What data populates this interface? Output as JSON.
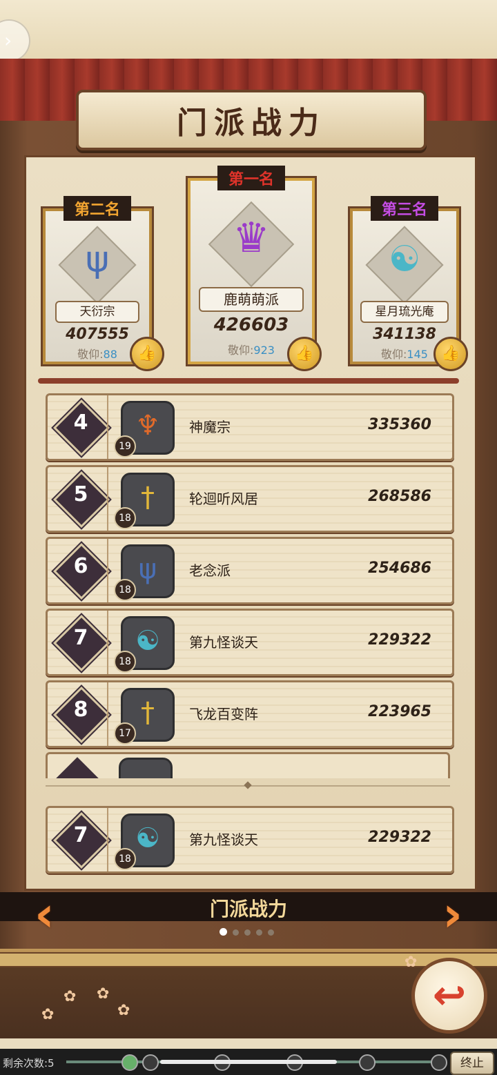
{
  "header": {
    "title": "门派战力"
  },
  "podium": [
    {
      "rank_label": "第二名",
      "rank_color": "#f2a531",
      "name": "天衍宗",
      "power": "407555",
      "respect_label": "敬仰:",
      "respect_value": "88",
      "emblem_icon": "trident-icon",
      "emblem_color": "#4a6fb5"
    },
    {
      "rank_label": "第一名",
      "rank_color": "#e0332a",
      "name": "鹿萌萌派",
      "power": "426603",
      "respect_label": "敬仰:",
      "respect_value": "923",
      "emblem_icon": "flame-crown-icon",
      "emblem_color": "#9a3bc9"
    },
    {
      "rank_label": "第三名",
      "rank_color": "#c44de3",
      "name": "星月琉光庵",
      "power": "341138",
      "respect_label": "敬仰:",
      "respect_value": "145",
      "emblem_icon": "taiji-icon",
      "emblem_color": "#4bb6c7"
    }
  ],
  "ranking_list": [
    {
      "rank": "4",
      "level": "19",
      "name": "神魔宗",
      "power": "335360",
      "icon": "demon-mask-icon",
      "icon_color": "#e06a2a"
    },
    {
      "rank": "5",
      "level": "18",
      "name": "轮迴听风居",
      "power": "268586",
      "icon": "sword-icon",
      "icon_color": "#e2b73a"
    },
    {
      "rank": "6",
      "level": "18",
      "name": "老念派",
      "power": "254686",
      "icon": "trident-icon",
      "icon_color": "#4a6fb5"
    },
    {
      "rank": "7",
      "level": "18",
      "name": "第九怪谈天",
      "power": "229322",
      "icon": "taiji-icon",
      "icon_color": "#4bb6c7"
    },
    {
      "rank": "8",
      "level": "17",
      "name": "飞龙百变阵",
      "power": "223965",
      "icon": "sword-icon",
      "icon_color": "#e2b73a"
    }
  ],
  "my_sect": {
    "rank": "7",
    "level": "18",
    "name": "第九怪谈天",
    "power": "229322",
    "icon": "taiji-icon",
    "icon_color": "#4bb6c7"
  },
  "footer": {
    "tab_title": "门派战力",
    "page_count": 5,
    "current_page": 1
  },
  "status_bar": {
    "remaining_label": "剩余次数:5",
    "stop_label": "终止"
  }
}
